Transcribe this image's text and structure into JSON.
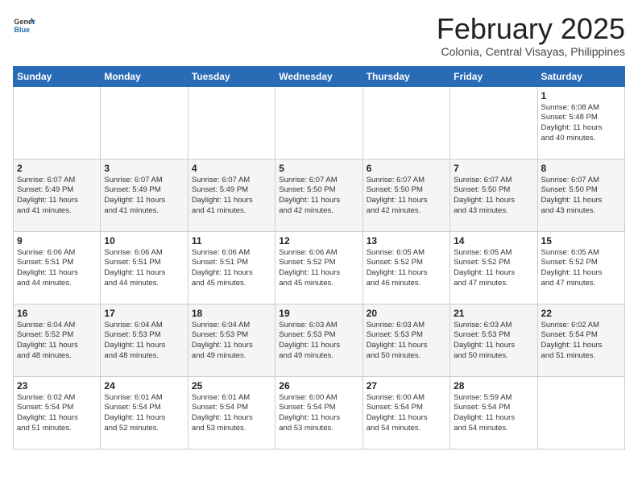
{
  "header": {
    "logo_general": "General",
    "logo_blue": "Blue",
    "month_title": "February 2025",
    "subtitle": "Colonia, Central Visayas, Philippines"
  },
  "weekdays": [
    "Sunday",
    "Monday",
    "Tuesday",
    "Wednesday",
    "Thursday",
    "Friday",
    "Saturday"
  ],
  "weeks": [
    [
      {
        "day": "",
        "info": ""
      },
      {
        "day": "",
        "info": ""
      },
      {
        "day": "",
        "info": ""
      },
      {
        "day": "",
        "info": ""
      },
      {
        "day": "",
        "info": ""
      },
      {
        "day": "",
        "info": ""
      },
      {
        "day": "1",
        "info": "Sunrise: 6:08 AM\nSunset: 5:48 PM\nDaylight: 11 hours\nand 40 minutes."
      }
    ],
    [
      {
        "day": "2",
        "info": "Sunrise: 6:07 AM\nSunset: 5:49 PM\nDaylight: 11 hours\nand 41 minutes."
      },
      {
        "day": "3",
        "info": "Sunrise: 6:07 AM\nSunset: 5:49 PM\nDaylight: 11 hours\nand 41 minutes."
      },
      {
        "day": "4",
        "info": "Sunrise: 6:07 AM\nSunset: 5:49 PM\nDaylight: 11 hours\nand 41 minutes."
      },
      {
        "day": "5",
        "info": "Sunrise: 6:07 AM\nSunset: 5:50 PM\nDaylight: 11 hours\nand 42 minutes."
      },
      {
        "day": "6",
        "info": "Sunrise: 6:07 AM\nSunset: 5:50 PM\nDaylight: 11 hours\nand 42 minutes."
      },
      {
        "day": "7",
        "info": "Sunrise: 6:07 AM\nSunset: 5:50 PM\nDaylight: 11 hours\nand 43 minutes."
      },
      {
        "day": "8",
        "info": "Sunrise: 6:07 AM\nSunset: 5:50 PM\nDaylight: 11 hours\nand 43 minutes."
      }
    ],
    [
      {
        "day": "9",
        "info": "Sunrise: 6:06 AM\nSunset: 5:51 PM\nDaylight: 11 hours\nand 44 minutes."
      },
      {
        "day": "10",
        "info": "Sunrise: 6:06 AM\nSunset: 5:51 PM\nDaylight: 11 hours\nand 44 minutes."
      },
      {
        "day": "11",
        "info": "Sunrise: 6:06 AM\nSunset: 5:51 PM\nDaylight: 11 hours\nand 45 minutes."
      },
      {
        "day": "12",
        "info": "Sunrise: 6:06 AM\nSunset: 5:52 PM\nDaylight: 11 hours\nand 45 minutes."
      },
      {
        "day": "13",
        "info": "Sunrise: 6:05 AM\nSunset: 5:52 PM\nDaylight: 11 hours\nand 46 minutes."
      },
      {
        "day": "14",
        "info": "Sunrise: 6:05 AM\nSunset: 5:52 PM\nDaylight: 11 hours\nand 47 minutes."
      },
      {
        "day": "15",
        "info": "Sunrise: 6:05 AM\nSunset: 5:52 PM\nDaylight: 11 hours\nand 47 minutes."
      }
    ],
    [
      {
        "day": "16",
        "info": "Sunrise: 6:04 AM\nSunset: 5:52 PM\nDaylight: 11 hours\nand 48 minutes."
      },
      {
        "day": "17",
        "info": "Sunrise: 6:04 AM\nSunset: 5:53 PM\nDaylight: 11 hours\nand 48 minutes."
      },
      {
        "day": "18",
        "info": "Sunrise: 6:04 AM\nSunset: 5:53 PM\nDaylight: 11 hours\nand 49 minutes."
      },
      {
        "day": "19",
        "info": "Sunrise: 6:03 AM\nSunset: 5:53 PM\nDaylight: 11 hours\nand 49 minutes."
      },
      {
        "day": "20",
        "info": "Sunrise: 6:03 AM\nSunset: 5:53 PM\nDaylight: 11 hours\nand 50 minutes."
      },
      {
        "day": "21",
        "info": "Sunrise: 6:03 AM\nSunset: 5:53 PM\nDaylight: 11 hours\nand 50 minutes."
      },
      {
        "day": "22",
        "info": "Sunrise: 6:02 AM\nSunset: 5:54 PM\nDaylight: 11 hours\nand 51 minutes."
      }
    ],
    [
      {
        "day": "23",
        "info": "Sunrise: 6:02 AM\nSunset: 5:54 PM\nDaylight: 11 hours\nand 51 minutes."
      },
      {
        "day": "24",
        "info": "Sunrise: 6:01 AM\nSunset: 5:54 PM\nDaylight: 11 hours\nand 52 minutes."
      },
      {
        "day": "25",
        "info": "Sunrise: 6:01 AM\nSunset: 5:54 PM\nDaylight: 11 hours\nand 53 minutes."
      },
      {
        "day": "26",
        "info": "Sunrise: 6:00 AM\nSunset: 5:54 PM\nDaylight: 11 hours\nand 53 minutes."
      },
      {
        "day": "27",
        "info": "Sunrise: 6:00 AM\nSunset: 5:54 PM\nDaylight: 11 hours\nand 54 minutes."
      },
      {
        "day": "28",
        "info": "Sunrise: 5:59 AM\nSunset: 5:54 PM\nDaylight: 11 hours\nand 54 minutes."
      },
      {
        "day": "",
        "info": ""
      }
    ]
  ],
  "colors": {
    "header_bg": "#2a6bb5",
    "header_text": "#ffffff",
    "accent": "#2a6bb5"
  }
}
